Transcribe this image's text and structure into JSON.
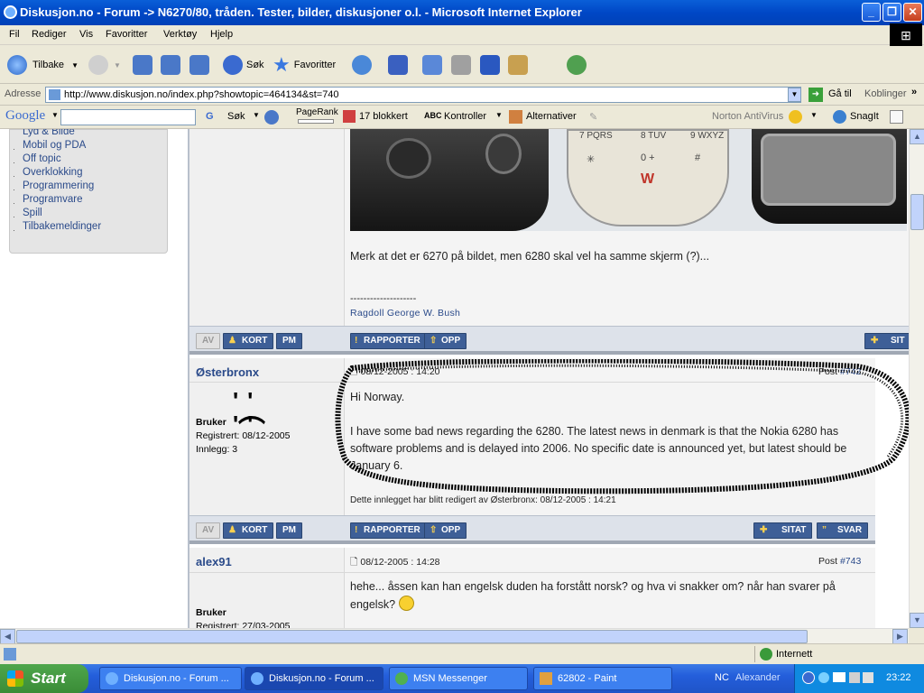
{
  "window": {
    "title": "Diskusjon.no - Forum -> N6270/80, tråden. Tester, bilder, diskusjoner o.l. - Microsoft Internet Explorer",
    "buttons": {
      "min": "_",
      "max": "❐",
      "close": "✕"
    }
  },
  "menu": [
    "Fil",
    "Rediger",
    "Vis",
    "Favoritter",
    "Verktøy",
    "Hjelp"
  ],
  "toolbar": {
    "back": "Tilbake",
    "search": "Søk",
    "favorites": "Favoritter"
  },
  "address": {
    "label": "Adresse",
    "url": "http://www.diskusjon.no/index.php?showtopic=464134&st=740",
    "go": "Gå til",
    "links": "Koblinger"
  },
  "googlebar": {
    "logo": "Google",
    "search": "Søk",
    "pagerank": "PageRank",
    "blocked": "17 blokkert",
    "check": "Kontroller",
    "alternatives": "Alternativer",
    "norton": "Norton AntiVirus",
    "snagit": "SnagIt"
  },
  "sidebar": {
    "items": [
      "Lyd & Bilde",
      "Mobil og PDA",
      "Off topic",
      "Overklokking",
      "Programmering",
      "Programvare",
      "Spill",
      "Tilbakemeldinger"
    ]
  },
  "post1": {
    "image_keys": [
      "7 PQRS",
      "8 TUV",
      "9 WXYZ",
      "0 +",
      "#"
    ],
    "text": "Merk at det er 6270 på bildet, men 6280 skal vel ha samme skjerm (?)...",
    "sig_line": "--------------------",
    "signature": "Ragdoll George W. Bush",
    "buttons": {
      "av": "AV",
      "kort": "KORT",
      "pm": "PM",
      "report": "RAPPORTER",
      "up": "OPP",
      "quote": "SIT"
    }
  },
  "post2": {
    "author": "Østerbronx",
    "date": "08/12-2005 : 14:20",
    "post_label": "Post",
    "post_num": "#742",
    "role": "Bruker",
    "registered": "Registrert: 08/12-2005",
    "posts": "Innlegg: 3",
    "greeting": "Hi Norway.",
    "body": "I have some bad news regarding the 6280. The latest news in denmark is that the Nokia 6280 has software problems and is delayed into 2006. No specific date is announced yet, but latest should be January 6.",
    "edited": "Dette innlegget har blitt redigert av Østerbronx: 08/12-2005 : 14:21",
    "buttons": {
      "av": "AV",
      "kort": "KORT",
      "pm": "PM",
      "report": "RAPPORTER",
      "up": "OPP",
      "quote": "SITAT",
      "reply": "SVAR"
    }
  },
  "post3": {
    "author": "alex91",
    "date": "08/12-2005 : 14:28",
    "post_label": "Post",
    "post_num": "#743",
    "role": "Bruker",
    "registered": "Registrert: 27/03-2005",
    "body": "hehe... åssen kan han engelsk duden ha forstått norsk? og hva vi snakker om? når han svarer på engelsk?"
  },
  "statusbar": {
    "zone": "Internett"
  },
  "taskbar": {
    "start": "Start",
    "tasks": [
      "Diskusjon.no - Forum ...",
      "Diskusjon.no - Forum ...",
      "MSN Messenger",
      "62802 - Paint"
    ],
    "lang": "NC",
    "user": "Alexander",
    "clock": "23:22"
  },
  "colors": {
    "link": "#2a4a8a",
    "button": "#3e5f97",
    "titlebar": "#0047c6",
    "taskbar": "#245edb"
  }
}
